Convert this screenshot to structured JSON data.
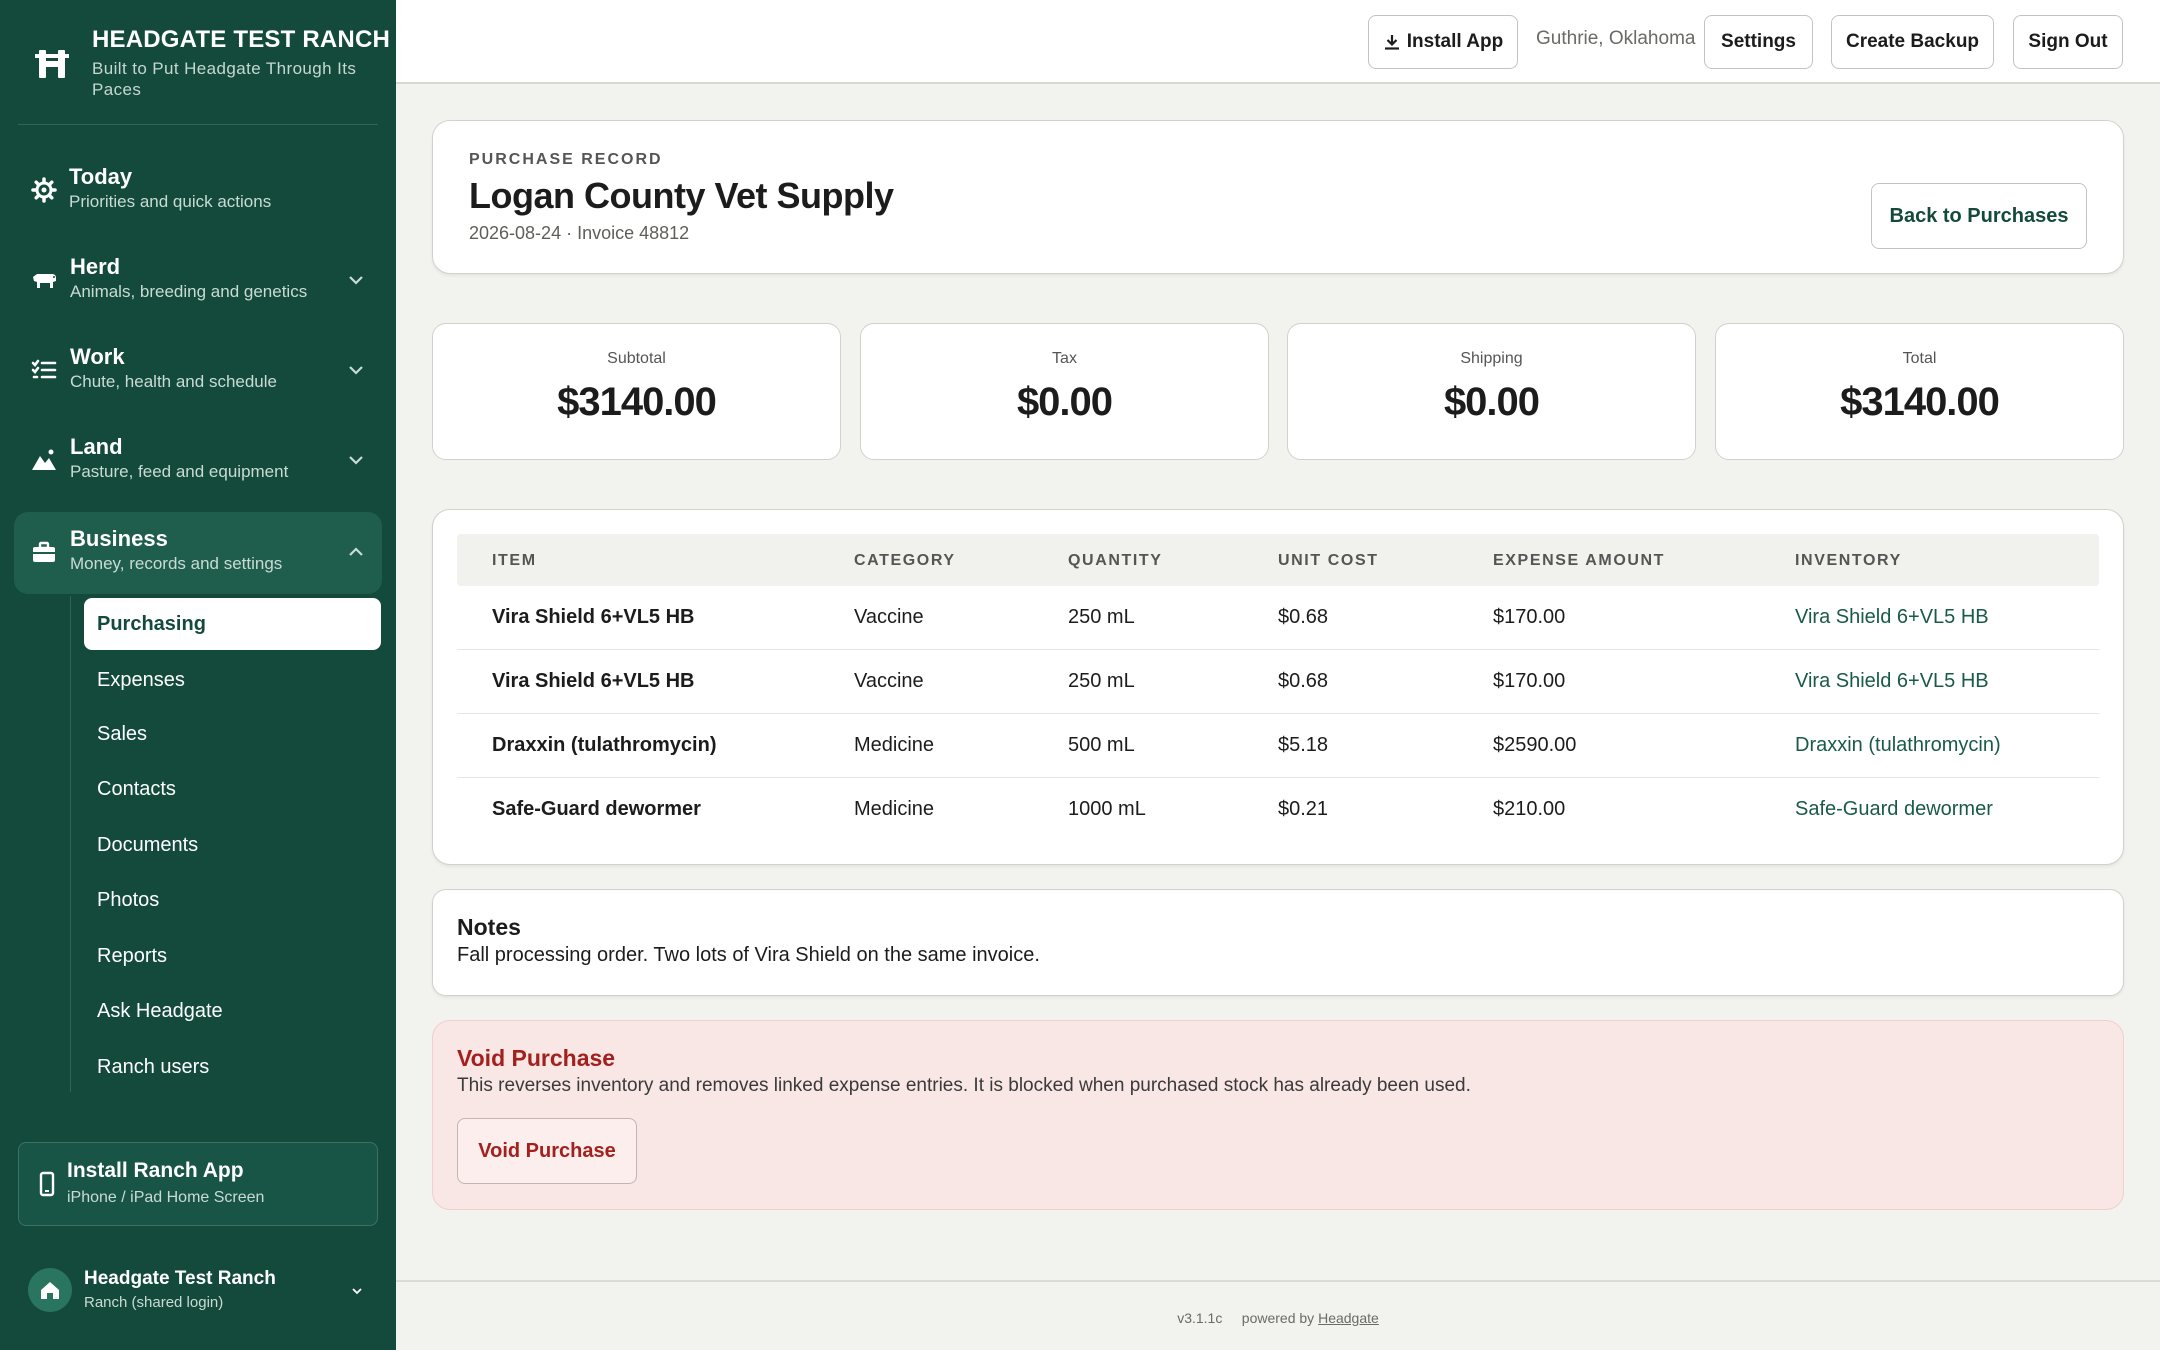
{
  "brand": {
    "title": "HEADGATE TEST RANCH",
    "subtitle": "Built to Put Headgate Through Its Paces",
    "logo_icon": "h-brand-icon"
  },
  "nav": {
    "groups": [
      {
        "title": "Today",
        "subtitle": "Priorities and quick actions",
        "icon": "gear-icon"
      },
      {
        "title": "Herd",
        "subtitle": "Animals, breeding and genetics",
        "icon": "cow-icon"
      },
      {
        "title": "Work",
        "subtitle": "Chute, health and schedule",
        "icon": "checklist-icon"
      },
      {
        "title": "Land",
        "subtitle": "Pasture, feed and equipment",
        "icon": "mountain-icon"
      },
      {
        "title": "Business",
        "subtitle": "Money, records and settings",
        "icon": "briefcase-icon"
      }
    ],
    "business_items": [
      "Purchasing",
      "Expenses",
      "Sales",
      "Contacts",
      "Documents",
      "Photos",
      "Reports",
      "Ask Headgate",
      "Ranch users"
    ],
    "current_item": "Purchasing"
  },
  "install_card": {
    "title": "Install Ranch App",
    "subtitle": "iPhone / iPad Home Screen"
  },
  "account": {
    "name": "Headgate Test Ranch",
    "role": "Ranch (shared login)"
  },
  "topbar": {
    "install_label": "Install App",
    "location": "Guthrie, Oklahoma",
    "settings_label": "Settings",
    "backup_label": "Create Backup",
    "signout_label": "Sign Out"
  },
  "record": {
    "eyebrow": "PURCHASE RECORD",
    "title": "Logan County Vet Supply",
    "meta": "2026-08-24 · Invoice 48812",
    "back_label": "Back to Purchases"
  },
  "stats": [
    {
      "label": "Subtotal",
      "value": "$3140.00"
    },
    {
      "label": "Tax",
      "value": "$0.00"
    },
    {
      "label": "Shipping",
      "value": "$0.00"
    },
    {
      "label": "Total",
      "value": "$3140.00"
    }
  ],
  "table": {
    "headers": [
      "ITEM",
      "CATEGORY",
      "QUANTITY",
      "UNIT COST",
      "EXPENSE AMOUNT",
      "INVENTORY"
    ],
    "rows": [
      {
        "item": "Vira Shield 6+VL5 HB",
        "category": "Vaccine",
        "quantity": "250 mL",
        "unit_cost": "$0.68",
        "amount": "$170.00",
        "inventory": "Vira Shield 6+VL5 HB"
      },
      {
        "item": "Vira Shield 6+VL5 HB",
        "category": "Vaccine",
        "quantity": "250 mL",
        "unit_cost": "$0.68",
        "amount": "$170.00",
        "inventory": "Vira Shield 6+VL5 HB"
      },
      {
        "item": "Draxxin (tulathromycin)",
        "category": "Medicine",
        "quantity": "500 mL",
        "unit_cost": "$5.18",
        "amount": "$2590.00",
        "inventory": "Draxxin (tulathromycin)"
      },
      {
        "item": "Safe-Guard dewormer",
        "category": "Medicine",
        "quantity": "1000 mL",
        "unit_cost": "$0.21",
        "amount": "$210.00",
        "inventory": "Safe-Guard dewormer"
      }
    ]
  },
  "notes": {
    "title": "Notes",
    "text": "Fall processing order. Two lots of Vira Shield on the same invoice."
  },
  "void": {
    "title": "Void Purchase",
    "text": "This reverses inventory and removes linked expense entries. It is blocked when purchased stock has already been used.",
    "button_label": "Void Purchase"
  },
  "footer": {
    "version": "v3.1.1c",
    "powered_prefix": "powered by",
    "powered_link": "Headgate"
  },
  "colors": {
    "sidebar": "#134a3c",
    "accent": "#1a5a48",
    "danger": "#a3201d",
    "danger_bg": "#f9e7e6"
  }
}
